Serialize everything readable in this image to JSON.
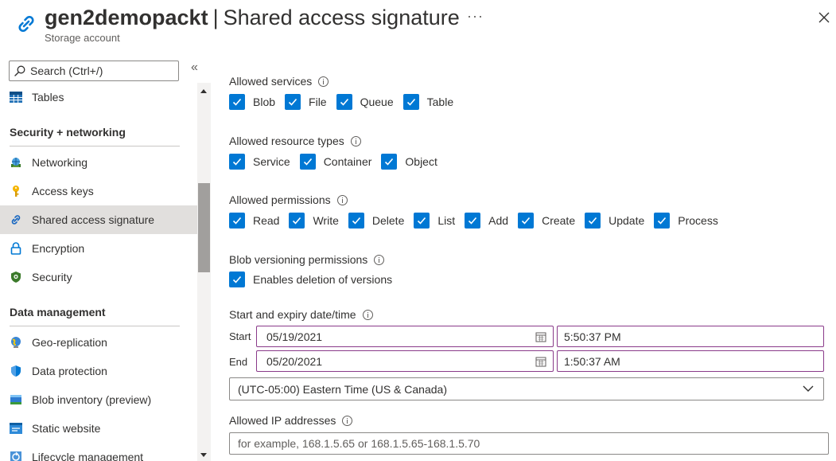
{
  "header": {
    "resource_name": "gen2demopackt",
    "separator": "|",
    "page_title": "Shared access signature",
    "subtitle": "Storage account",
    "more_icon": "ellipsis-icon",
    "close_icon": "close-icon"
  },
  "sidebar": {
    "search_placeholder": "Search (Ctrl+/)",
    "collapse_glyph": "«",
    "items": [
      {
        "label": "Tables",
        "icon": "tables-icon",
        "type": "item"
      },
      {
        "label": "Security + networking",
        "type": "section"
      },
      {
        "label": "Networking",
        "icon": "networking-icon",
        "type": "item"
      },
      {
        "label": "Access keys",
        "icon": "key-icon",
        "type": "item"
      },
      {
        "label": "Shared access signature",
        "icon": "link-icon",
        "type": "item",
        "selected": true
      },
      {
        "label": "Encryption",
        "icon": "lock-icon",
        "type": "item"
      },
      {
        "label": "Security",
        "icon": "shield-icon",
        "type": "item"
      },
      {
        "label": "Data management",
        "type": "section"
      },
      {
        "label": "Geo-replication",
        "icon": "globe-icon",
        "type": "item"
      },
      {
        "label": "Data protection",
        "icon": "shield-blue-icon",
        "type": "item"
      },
      {
        "label": "Blob inventory (preview)",
        "icon": "inventory-icon",
        "type": "item"
      },
      {
        "label": "Static website",
        "icon": "website-icon",
        "type": "item"
      },
      {
        "label": "Lifecycle management",
        "icon": "lifecycle-icon",
        "type": "item"
      }
    ]
  },
  "form": {
    "allowed_services": {
      "label": "Allowed services",
      "options": [
        {
          "label": "Blob",
          "checked": true
        },
        {
          "label": "File",
          "checked": true
        },
        {
          "label": "Queue",
          "checked": true
        },
        {
          "label": "Table",
          "checked": true
        }
      ]
    },
    "allowed_resource_types": {
      "label": "Allowed resource types",
      "options": [
        {
          "label": "Service",
          "checked": true
        },
        {
          "label": "Container",
          "checked": true
        },
        {
          "label": "Object",
          "checked": true
        }
      ]
    },
    "allowed_permissions": {
      "label": "Allowed permissions",
      "options": [
        {
          "label": "Read",
          "checked": true
        },
        {
          "label": "Write",
          "checked": true
        },
        {
          "label": "Delete",
          "checked": true
        },
        {
          "label": "List",
          "checked": true
        },
        {
          "label": "Add",
          "checked": true
        },
        {
          "label": "Create",
          "checked": true
        },
        {
          "label": "Update",
          "checked": true
        },
        {
          "label": "Process",
          "checked": true
        }
      ]
    },
    "blob_versioning": {
      "label": "Blob versioning permissions",
      "options": [
        {
          "label": "Enables deletion of versions",
          "checked": true
        }
      ]
    },
    "datetime": {
      "label": "Start and expiry date/time",
      "start_label": "Start",
      "start_date": "05/19/2021",
      "start_time": "5:50:37 PM",
      "end_label": "End",
      "end_date": "05/20/2021",
      "end_time": "1:50:37 AM",
      "timezone": "(UTC-05:00) Eastern Time (US & Canada)"
    },
    "allowed_ip": {
      "label": "Allowed IP addresses",
      "placeholder": "for example, 168.1.5.65 or 168.1.5.65-168.1.5.70"
    }
  },
  "colors": {
    "accent": "#0078d4",
    "selected_bg": "#e1dfdd",
    "focus_border": "#8a3a8a"
  }
}
